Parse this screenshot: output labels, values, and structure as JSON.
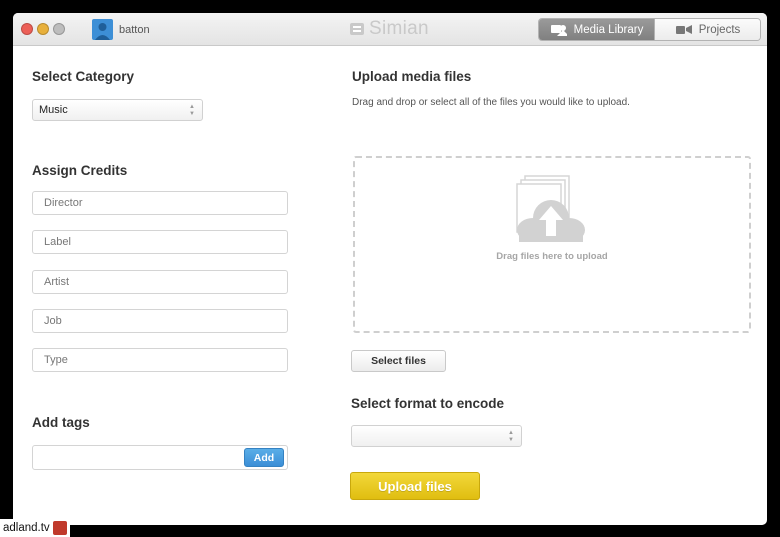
{
  "window": {
    "username": "batton",
    "app_name": "Simian",
    "tabs": [
      {
        "label": "Media Library",
        "active": true,
        "icon": "media-library-icon"
      },
      {
        "label": "Projects",
        "active": false,
        "icon": "projects-icon"
      }
    ]
  },
  "left": {
    "category_heading": "Select Category",
    "category_value": "Music",
    "credits_heading": "Assign Credits",
    "credit_fields": [
      "Director",
      "Label",
      "Artist",
      "Job",
      "Type"
    ],
    "tags_heading": "Add tags",
    "tags_value": "",
    "add_button": "Add"
  },
  "right": {
    "upload_heading": "Upload media files",
    "upload_description": "Drag and drop or select all of the files you would like to upload.",
    "dropzone_text": "Drag files here to upload",
    "select_files_button": "Select files",
    "format_heading": "Select format to encode",
    "format_value": "",
    "upload_button": "Upload files"
  },
  "watermark": "adland.tv",
  "colors": {
    "accent_blue": "#3b8ed6",
    "upload_yellow": "#e8c824",
    "active_tab": "#8c8c8c"
  }
}
